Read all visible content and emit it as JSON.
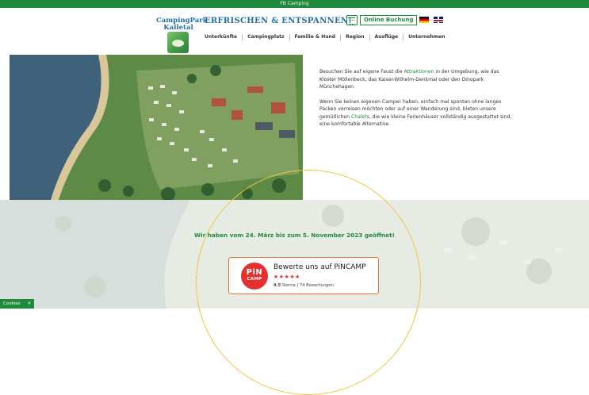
{
  "topbar": {
    "label": "FB Camping"
  },
  "header": {
    "logo_line1": "CampingPark",
    "logo_line2": "Kalletal",
    "tagline": "ERFRISCHEN & ENTSPANNEN!",
    "booking": "Online Buchung",
    "calendar_icon": "calendar-icon"
  },
  "nav": {
    "items": [
      "Unterkünfte",
      "Campingplatz",
      "Familie & Hund",
      "Region",
      "Ausflüge",
      "Unternehmen"
    ]
  },
  "hero": {
    "p1_before": "Besuchen Sie auf eigene Faust die ",
    "p1_link": "Attraktionen",
    "p1_after": " in der Umgebung, wie das Kloster Möllenbeck, das Kaiser-Wilhelm-Denkmal oder den Dinopark Münchehagen.",
    "p2_before": "Wenn Sie keinen eigenen Camper haben, einfach mal spontan ohne langes Packen verreisen möchten oder auf einer Wanderung sind, bieten unsere gemütlichen ",
    "p2_link": "Chalets",
    "p2_after": ", die wie kleine Ferienhäuser vollständig ausgestattet sind, eine komfortable Alternative."
  },
  "opening": "Wir haben vom 24. März bis zum 5. November 2023 geöffnet!",
  "pincamp": {
    "logo_a": "PiN",
    "logo_b": "CAMP",
    "title": "Bewerte uns auf PiNCAMP",
    "stars": "★★★★★",
    "rating_value": "4.5",
    "rating_text": " Sterne | 74 Bewertungen"
  },
  "cookies": {
    "label": "Cookies",
    "close": "✕"
  },
  "colors": {
    "brand_green": "#1f8a3b",
    "brand_blue": "#1e6fa8",
    "pincamp_red": "#e53030",
    "circle_yellow": "#f2c53d"
  }
}
